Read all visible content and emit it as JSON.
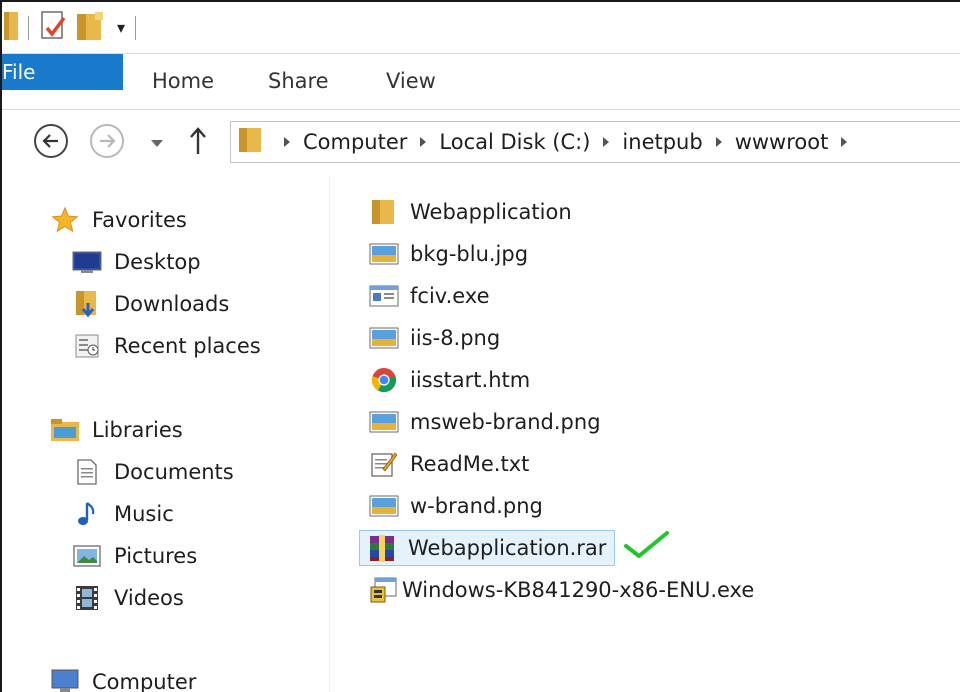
{
  "ribbon": {
    "tabs": [
      "File",
      "Home",
      "Share",
      "View"
    ]
  },
  "address": {
    "crumbs": [
      "Computer",
      "Local Disk (C:)",
      "inetpub",
      "wwwroot"
    ]
  },
  "nav": {
    "favorites": "Favorites",
    "desktop": "Desktop",
    "downloads": "Downloads",
    "recent": "Recent places",
    "libraries": "Libraries",
    "documents": "Documents",
    "music": "Music",
    "pictures": "Pictures",
    "videos": "Videos",
    "computer": "Computer"
  },
  "files": [
    {
      "name": "Webapplication",
      "icon": "folder-icon"
    },
    {
      "name": "bkg-blu.jpg",
      "icon": "image-icon"
    },
    {
      "name": "fciv.exe",
      "icon": "exe-icon"
    },
    {
      "name": "iis-8.png",
      "icon": "image-icon"
    },
    {
      "name": "iisstart.htm",
      "icon": "chrome-icon"
    },
    {
      "name": "msweb-brand.png",
      "icon": "image-icon"
    },
    {
      "name": "ReadMe.txt",
      "icon": "text-file-icon"
    },
    {
      "name": "w-brand.png",
      "icon": "image-icon"
    },
    {
      "name": "Webapplication.rar",
      "icon": "winrar-icon",
      "selected": true
    },
    {
      "name": "Windows-KB841290-x86-ENU.exe",
      "icon": "installer-icon"
    }
  ],
  "colors": {
    "file_tab": "#1979ca",
    "selection_bg": "#e5f1fb",
    "selection_border": "#99c9ef",
    "checkmark": "#22c52a"
  }
}
